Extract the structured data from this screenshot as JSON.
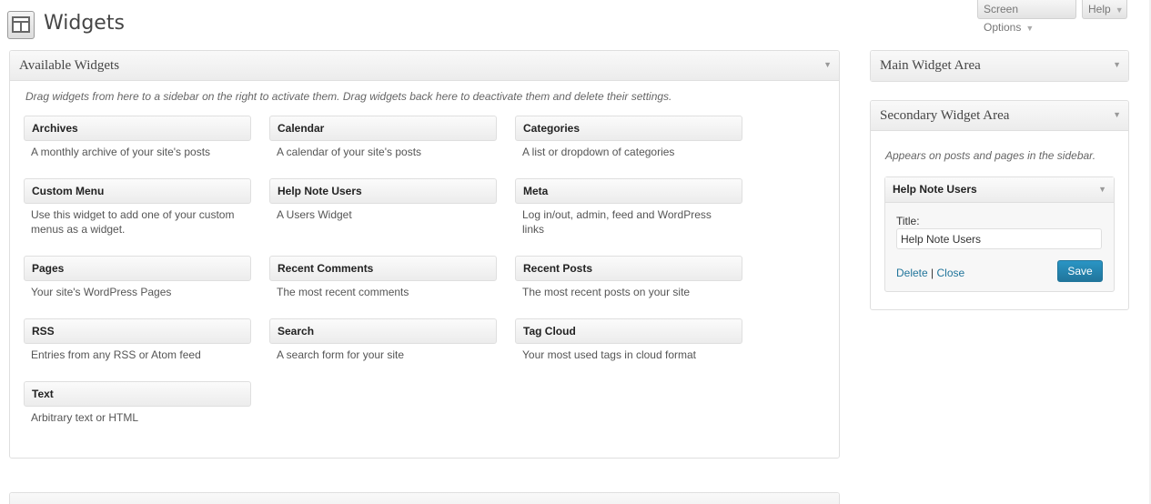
{
  "page": {
    "title": "Widgets"
  },
  "top_buttons": {
    "screen_options": "Screen Options",
    "help": "Help"
  },
  "available": {
    "title": "Available Widgets",
    "description": "Drag widgets from here to a sidebar on the right to activate them. Drag widgets back here to deactivate them and delete their settings.",
    "widgets": [
      {
        "name": "Archives",
        "desc": "A monthly archive of your site's posts"
      },
      {
        "name": "Calendar",
        "desc": "A calendar of your site's posts"
      },
      {
        "name": "Categories",
        "desc": "A list or dropdown of categories"
      },
      {
        "name": "Custom Menu",
        "desc": "Use this widget to add one of your custom menus as a widget."
      },
      {
        "name": "Help Note Users",
        "desc": "A Users Widget"
      },
      {
        "name": "Meta",
        "desc": "Log in/out, admin, feed and WordPress links"
      },
      {
        "name": "Pages",
        "desc": "Your site's WordPress Pages"
      },
      {
        "name": "Recent Comments",
        "desc": "The most recent comments"
      },
      {
        "name": "Recent Posts",
        "desc": "The most recent posts on your site"
      },
      {
        "name": "RSS",
        "desc": "Entries from any RSS or Atom feed"
      },
      {
        "name": "Search",
        "desc": "A search form for your site"
      },
      {
        "name": "Tag Cloud",
        "desc": "Your most used tags in cloud format"
      },
      {
        "name": "Text",
        "desc": "Arbitrary text or HTML"
      }
    ]
  },
  "main_area": {
    "title": "Main Widget Area"
  },
  "secondary_area": {
    "title": "Secondary Widget Area",
    "description": "Appears on posts and pages in the sidebar.",
    "widget": {
      "name": "Help Note Users",
      "field_label": "Title:",
      "field_value": "Help Note Users",
      "delete": "Delete",
      "separator": "|",
      "close": "Close",
      "save": "Save"
    }
  },
  "icons": {
    "page": "widgets-window-icon",
    "toggle": "triangle-down-icon"
  }
}
